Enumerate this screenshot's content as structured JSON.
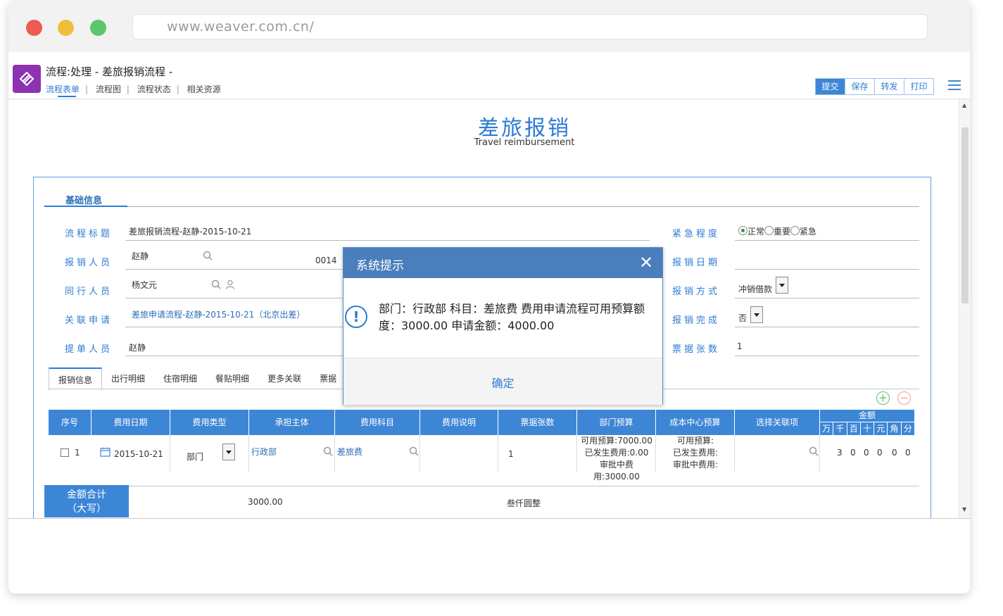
{
  "browser": {
    "url": "www.weaver.com.cn/"
  },
  "app": {
    "title": "流程:处理 - 差旅报销流程 -",
    "subnav": [
      "流程表单",
      "流程图",
      "流程状态",
      "相关资源"
    ],
    "buttons": [
      "提交",
      "保存",
      "转发",
      "打印"
    ],
    "menu_icon": "list-menu-icon"
  },
  "document": {
    "title": "差旅报销",
    "subtitle": "Travel reimbursement"
  },
  "basic": {
    "section_title": "基础信息",
    "labels": {
      "title": "流程标题",
      "person": "报销人员",
      "companion": "同行人员",
      "related": "关联申请",
      "submitter": "提单人员",
      "urgency": "紧急程度",
      "date": "报销日期",
      "method": "报销方式",
      "completed": "报销完成",
      "receipts": "票据张数"
    },
    "values": {
      "title": "差旅报销流程-赵静-2015-10-21",
      "person": "赵静",
      "person_code": "0014",
      "companion": "杨文元",
      "related": "差旅申请流程-赵静-2015-10-21（北京出差）",
      "submitter": "赵静",
      "urgency_options": [
        "正常",
        "重要",
        "紧急"
      ],
      "urgency_selected": "正常",
      "date": "",
      "method": "冲销借款",
      "completed": "否",
      "receipts": "1"
    }
  },
  "tabs": [
    "报销信息",
    "出行明细",
    "住宿明细",
    "餐贴明细",
    "更多关联",
    "票据"
  ],
  "table": {
    "headers": [
      "序号",
      "费用日期",
      "费用类型",
      "承担主体",
      "费用科目",
      "费用说明",
      "票据张数",
      "部门预算",
      "成本中心预算",
      "选择关联项"
    ],
    "money_header": "金额",
    "money_units": [
      "万",
      "千",
      "百",
      "十",
      "元",
      "角",
      "分"
    ],
    "row": {
      "index": "1",
      "date": "2015-10-21",
      "type": "部门",
      "entity": "行政部",
      "subject": "差旅费",
      "desc": "",
      "receipts": "1",
      "dept_budget": [
        "可用预算:7000.00",
        "已发生费用:0.00",
        "审批中费用:3000.00"
      ],
      "cost_budget": [
        "可用预算:",
        "已发生费用:",
        "审批中费用:"
      ],
      "money_digits": [
        "3",
        "0",
        "0",
        "0",
        "0",
        "0"
      ]
    }
  },
  "total": {
    "label_line1": "金额合计",
    "label_line2": "（大写）",
    "amount": "3000.00",
    "amount_cn": "叁仟圆整"
  },
  "modal": {
    "title": "系统提示",
    "message": "部门：行政部 科目：差旅费 费用申请流程可用预算额度：3000.00 申请金额：4000.00",
    "ok": "确定"
  },
  "colors": {
    "accent": "#2d7bd5",
    "header_blue": "#3d86d6",
    "modal_blue": "#4a7ebc",
    "logo": "#8d32b0"
  }
}
